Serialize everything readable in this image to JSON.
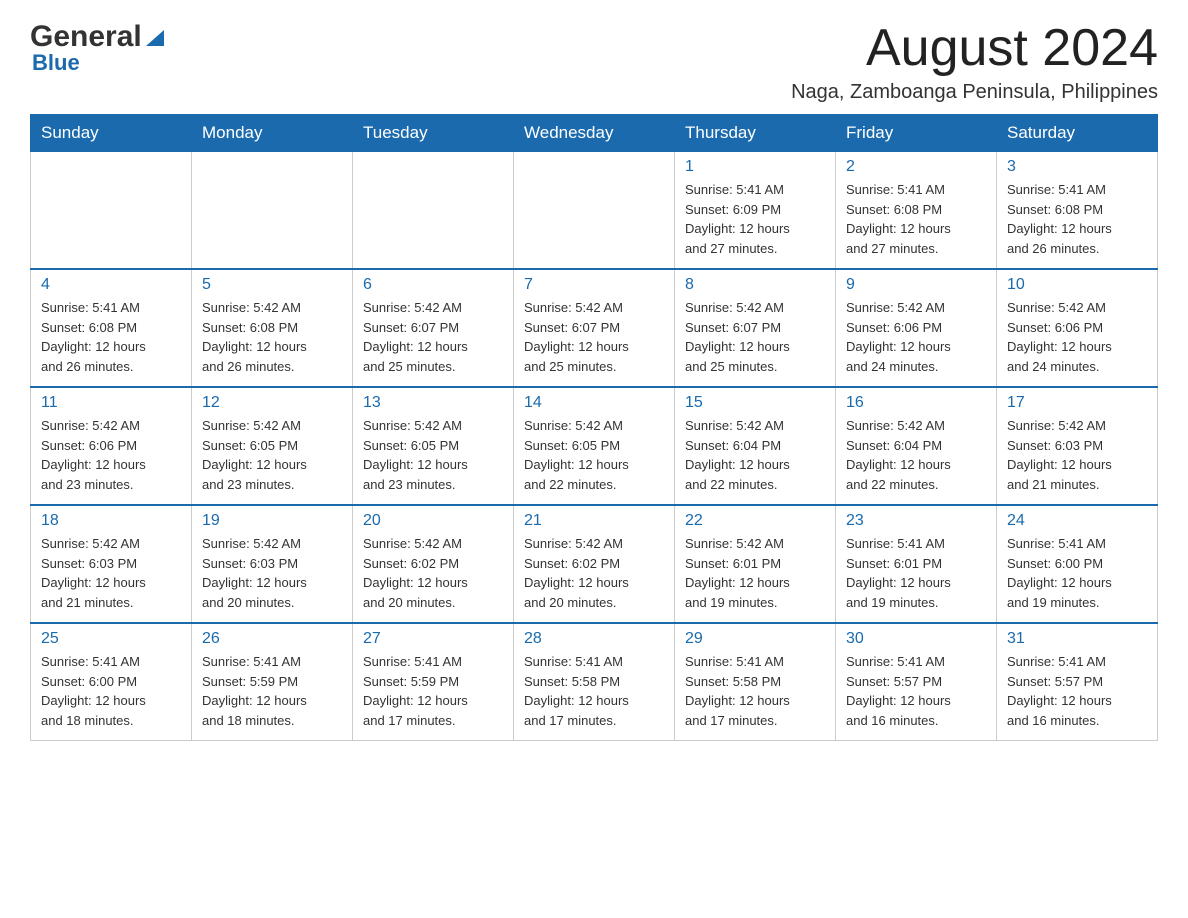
{
  "logo": {
    "general": "General",
    "blue": "Blue"
  },
  "header": {
    "title": "August 2024",
    "subtitle": "Naga, Zamboanga Peninsula, Philippines"
  },
  "days_of_week": [
    "Sunday",
    "Monday",
    "Tuesday",
    "Wednesday",
    "Thursday",
    "Friday",
    "Saturday"
  ],
  "weeks": [
    [
      {
        "day": "",
        "info": ""
      },
      {
        "day": "",
        "info": ""
      },
      {
        "day": "",
        "info": ""
      },
      {
        "day": "",
        "info": ""
      },
      {
        "day": "1",
        "info": "Sunrise: 5:41 AM\nSunset: 6:09 PM\nDaylight: 12 hours\nand 27 minutes."
      },
      {
        "day": "2",
        "info": "Sunrise: 5:41 AM\nSunset: 6:08 PM\nDaylight: 12 hours\nand 27 minutes."
      },
      {
        "day": "3",
        "info": "Sunrise: 5:41 AM\nSunset: 6:08 PM\nDaylight: 12 hours\nand 26 minutes."
      }
    ],
    [
      {
        "day": "4",
        "info": "Sunrise: 5:41 AM\nSunset: 6:08 PM\nDaylight: 12 hours\nand 26 minutes."
      },
      {
        "day": "5",
        "info": "Sunrise: 5:42 AM\nSunset: 6:08 PM\nDaylight: 12 hours\nand 26 minutes."
      },
      {
        "day": "6",
        "info": "Sunrise: 5:42 AM\nSunset: 6:07 PM\nDaylight: 12 hours\nand 25 minutes."
      },
      {
        "day": "7",
        "info": "Sunrise: 5:42 AM\nSunset: 6:07 PM\nDaylight: 12 hours\nand 25 minutes."
      },
      {
        "day": "8",
        "info": "Sunrise: 5:42 AM\nSunset: 6:07 PM\nDaylight: 12 hours\nand 25 minutes."
      },
      {
        "day": "9",
        "info": "Sunrise: 5:42 AM\nSunset: 6:06 PM\nDaylight: 12 hours\nand 24 minutes."
      },
      {
        "day": "10",
        "info": "Sunrise: 5:42 AM\nSunset: 6:06 PM\nDaylight: 12 hours\nand 24 minutes."
      }
    ],
    [
      {
        "day": "11",
        "info": "Sunrise: 5:42 AM\nSunset: 6:06 PM\nDaylight: 12 hours\nand 23 minutes."
      },
      {
        "day": "12",
        "info": "Sunrise: 5:42 AM\nSunset: 6:05 PM\nDaylight: 12 hours\nand 23 minutes."
      },
      {
        "day": "13",
        "info": "Sunrise: 5:42 AM\nSunset: 6:05 PM\nDaylight: 12 hours\nand 23 minutes."
      },
      {
        "day": "14",
        "info": "Sunrise: 5:42 AM\nSunset: 6:05 PM\nDaylight: 12 hours\nand 22 minutes."
      },
      {
        "day": "15",
        "info": "Sunrise: 5:42 AM\nSunset: 6:04 PM\nDaylight: 12 hours\nand 22 minutes."
      },
      {
        "day": "16",
        "info": "Sunrise: 5:42 AM\nSunset: 6:04 PM\nDaylight: 12 hours\nand 22 minutes."
      },
      {
        "day": "17",
        "info": "Sunrise: 5:42 AM\nSunset: 6:03 PM\nDaylight: 12 hours\nand 21 minutes."
      }
    ],
    [
      {
        "day": "18",
        "info": "Sunrise: 5:42 AM\nSunset: 6:03 PM\nDaylight: 12 hours\nand 21 minutes."
      },
      {
        "day": "19",
        "info": "Sunrise: 5:42 AM\nSunset: 6:03 PM\nDaylight: 12 hours\nand 20 minutes."
      },
      {
        "day": "20",
        "info": "Sunrise: 5:42 AM\nSunset: 6:02 PM\nDaylight: 12 hours\nand 20 minutes."
      },
      {
        "day": "21",
        "info": "Sunrise: 5:42 AM\nSunset: 6:02 PM\nDaylight: 12 hours\nand 20 minutes."
      },
      {
        "day": "22",
        "info": "Sunrise: 5:42 AM\nSunset: 6:01 PM\nDaylight: 12 hours\nand 19 minutes."
      },
      {
        "day": "23",
        "info": "Sunrise: 5:41 AM\nSunset: 6:01 PM\nDaylight: 12 hours\nand 19 minutes."
      },
      {
        "day": "24",
        "info": "Sunrise: 5:41 AM\nSunset: 6:00 PM\nDaylight: 12 hours\nand 19 minutes."
      }
    ],
    [
      {
        "day": "25",
        "info": "Sunrise: 5:41 AM\nSunset: 6:00 PM\nDaylight: 12 hours\nand 18 minutes."
      },
      {
        "day": "26",
        "info": "Sunrise: 5:41 AM\nSunset: 5:59 PM\nDaylight: 12 hours\nand 18 minutes."
      },
      {
        "day": "27",
        "info": "Sunrise: 5:41 AM\nSunset: 5:59 PM\nDaylight: 12 hours\nand 17 minutes."
      },
      {
        "day": "28",
        "info": "Sunrise: 5:41 AM\nSunset: 5:58 PM\nDaylight: 12 hours\nand 17 minutes."
      },
      {
        "day": "29",
        "info": "Sunrise: 5:41 AM\nSunset: 5:58 PM\nDaylight: 12 hours\nand 17 minutes."
      },
      {
        "day": "30",
        "info": "Sunrise: 5:41 AM\nSunset: 5:57 PM\nDaylight: 12 hours\nand 16 minutes."
      },
      {
        "day": "31",
        "info": "Sunrise: 5:41 AM\nSunset: 5:57 PM\nDaylight: 12 hours\nand 16 minutes."
      }
    ]
  ]
}
